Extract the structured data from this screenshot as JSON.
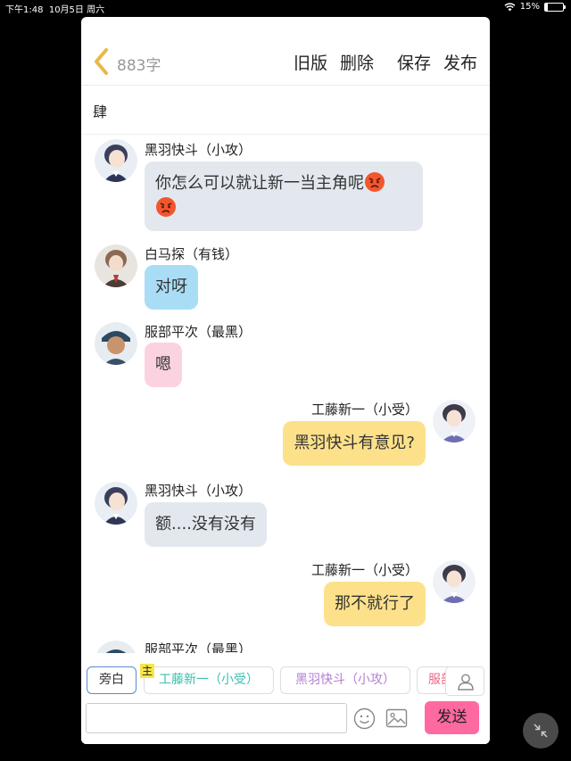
{
  "status_bar": {
    "time": "下午1:48",
    "date": "10月5日 周六",
    "battery": "15%",
    "battery_level": 0.15
  },
  "header": {
    "word_count": "883字",
    "actions": [
      "旧版",
      "删除",
      "保存",
      "发布"
    ]
  },
  "title": "肆",
  "messages": [
    {
      "sender": "黑羽快斗（小攻）",
      "text": "你怎么可以就让新一当主角呢",
      "emoji": "angry-face-emoji",
      "side": "left",
      "bubble_color": "#e3e8ef"
    },
    {
      "sender": "白马探（有钱）",
      "text": "对呀",
      "side": "left",
      "bubble_color": "#a9ddf6"
    },
    {
      "sender": "服部平次（最黑）",
      "text": "嗯",
      "side": "left",
      "bubble_color": "#fbd3e0"
    },
    {
      "sender": "工藤新一（小受）",
      "text": "黑羽快斗有意见?",
      "side": "right",
      "bubble_color": "#fde18a"
    },
    {
      "sender": "黑羽快斗（小攻）",
      "text": "额....没有没有",
      "side": "left",
      "bubble_color": "#e3e8ef"
    },
    {
      "sender": "工藤新一（小受）",
      "text": "那不就行了",
      "side": "right",
      "bubble_color": "#fde18a"
    },
    {
      "sender": "服部平次（最黑）",
      "text": "",
      "side": "left"
    }
  ],
  "composer": {
    "roles": [
      "旁白",
      "工藤新一（小受）",
      "黑羽快斗（小攻）",
      "服部"
    ],
    "main_tag": "主",
    "input_value": "",
    "input_placeholder": "",
    "send_label": "发送"
  },
  "colors": {
    "accent_send": "#ff69a1",
    "back_chevron": "#e8b84a",
    "main_tag_bg": "#f5e64a"
  },
  "icons": [
    "back-chevron-icon",
    "wifi-icon",
    "battery-icon",
    "person-icon",
    "emoji-icon",
    "image-icon",
    "collapse-icon"
  ]
}
